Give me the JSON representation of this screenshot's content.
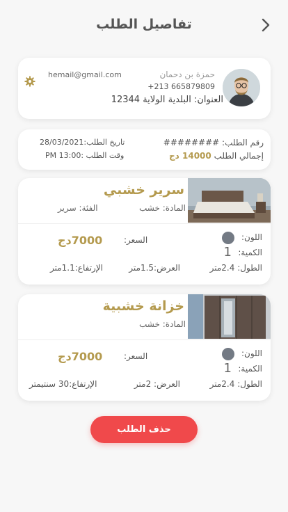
{
  "header": {
    "title": "تفاصيل الطلب"
  },
  "customer": {
    "name": "حمزة بن دحمان",
    "phone": "+213 665879809",
    "address": "العنوان: البلدية الولاية 12344",
    "email": "hemail@gmail.com"
  },
  "order": {
    "number_label": "رقم الطلب: ########",
    "total_label": "إجمالي الطلب",
    "total_value": "14000 دج",
    "date_label": "تاريخ الطلب:28/03/2021",
    "time_label": "وقت الطلب :13:00 PM"
  },
  "products": [
    {
      "name": "سرير خشبي",
      "material": "المادة: خشب",
      "category": "الفئة: سرير",
      "color_label": "اللون:",
      "qty_label": "الكمية:",
      "qty_value": "1",
      "price_label": "السعر:",
      "price_value": "7000دج",
      "length": "الطول: 2.4متر",
      "width": "العرض:1.5متر",
      "height": "الإرتفاع:1.1متر"
    },
    {
      "name": "خزانة خشبية",
      "material": "المادة: خشب",
      "color_label": "اللون:",
      "qty_label": "الكمية:",
      "qty_value": "1",
      "price_label": "السعر:",
      "price_value": "7000دج",
      "length": "الطول: 2.4متر",
      "width": "العرض: 2متر",
      "height": "الإرتفاع:30 سنتيمتر"
    }
  ],
  "actions": {
    "delete_label": "حذف الطلب"
  },
  "colors": {
    "accent": "#b49a4e",
    "danger": "#f0494b",
    "swatch": "#737a84"
  }
}
